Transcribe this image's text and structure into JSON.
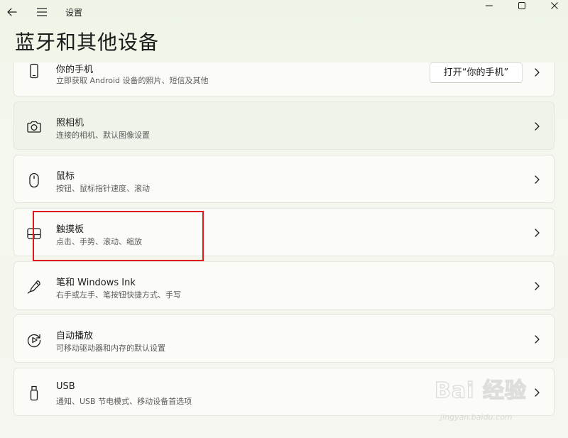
{
  "window": {
    "app_title": "设置"
  },
  "page": {
    "title": "蓝牙和其他设备"
  },
  "items": [
    {
      "title": "你的手机",
      "desc": "立即获取 Android 设备的照片、短信及其他",
      "button_label": "打开“你的手机”",
      "icon": "phone-icon"
    },
    {
      "title": "照相机",
      "desc": "连接的相机、默认图像设置",
      "icon": "camera-icon"
    },
    {
      "title": "鼠标",
      "desc": "按钮、鼠标指针速度、滚动",
      "icon": "mouse-icon"
    },
    {
      "title": "触摸板",
      "desc": "点击、手势、滚动、缩放",
      "icon": "touchpad-icon"
    },
    {
      "title": "笔和 Windows Ink",
      "desc": "右手或左手、笔按钮快捷方式、手写",
      "icon": "pen-icon"
    },
    {
      "title": "自动播放",
      "desc": "可移动驱动器和内存的默认设置",
      "icon": "autoplay-icon"
    },
    {
      "title": "USB",
      "desc": "通知、USB 节电模式、移动设备首选项",
      "icon": "usb-icon"
    }
  ],
  "watermark": {
    "logo": "Bai 经验",
    "url": "jingyan.baidu.com"
  },
  "colors": {
    "highlight": "#e0191e",
    "card_bg": "#fbfcf8",
    "page_bg": "#f1f6ea"
  }
}
